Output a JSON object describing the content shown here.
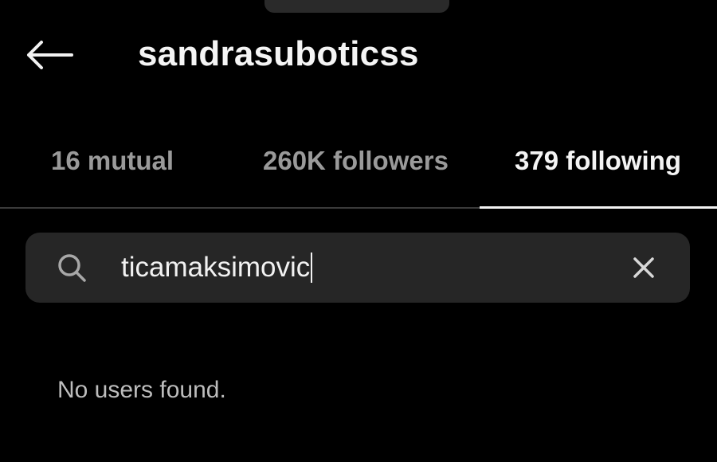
{
  "header": {
    "username": "sandrasuboticss"
  },
  "tabs": [
    {
      "label": "16 mutual",
      "active": false
    },
    {
      "label": "260K followers",
      "active": false
    },
    {
      "label": "379 following",
      "active": true
    }
  ],
  "search": {
    "value": "ticamaksimovic"
  },
  "results": {
    "empty_message": "No users found."
  },
  "colors": {
    "background": "#000000",
    "search_bg": "#262626",
    "active_tab": "#f4f4f4",
    "inactive_tab": "#9a9a9a",
    "divider": "#3a3a3a"
  },
  "icons": {
    "back": "arrow-left-icon",
    "search": "search-icon",
    "clear": "close-icon"
  }
}
